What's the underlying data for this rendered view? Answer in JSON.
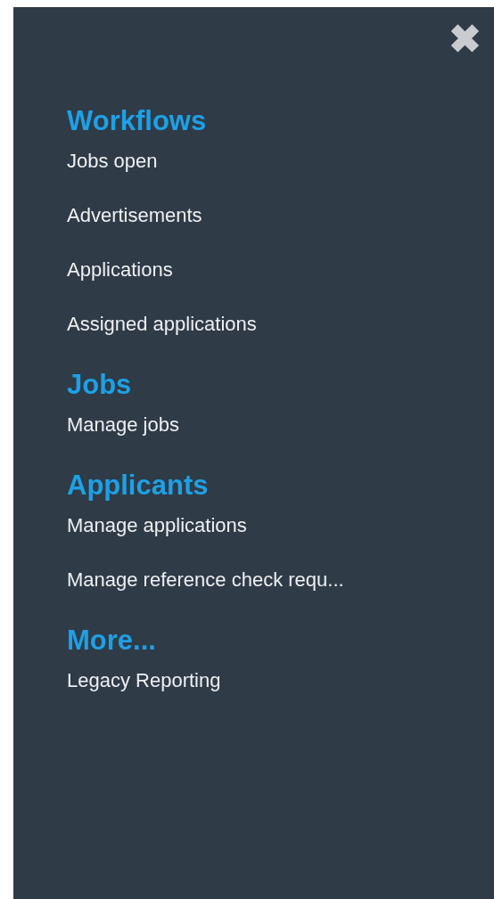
{
  "close_button": {
    "label": "✖"
  },
  "sections": [
    {
      "heading": "Workflows",
      "items": [
        "Jobs open",
        "Advertisements",
        "Applications",
        "Assigned applications"
      ]
    },
    {
      "heading": "Jobs",
      "items": [
        "Manage jobs"
      ]
    },
    {
      "heading": "Applicants",
      "items": [
        "Manage applications",
        "Manage reference check requ..."
      ]
    },
    {
      "heading": "More...",
      "items": [
        "Legacy Reporting"
      ]
    }
  ]
}
